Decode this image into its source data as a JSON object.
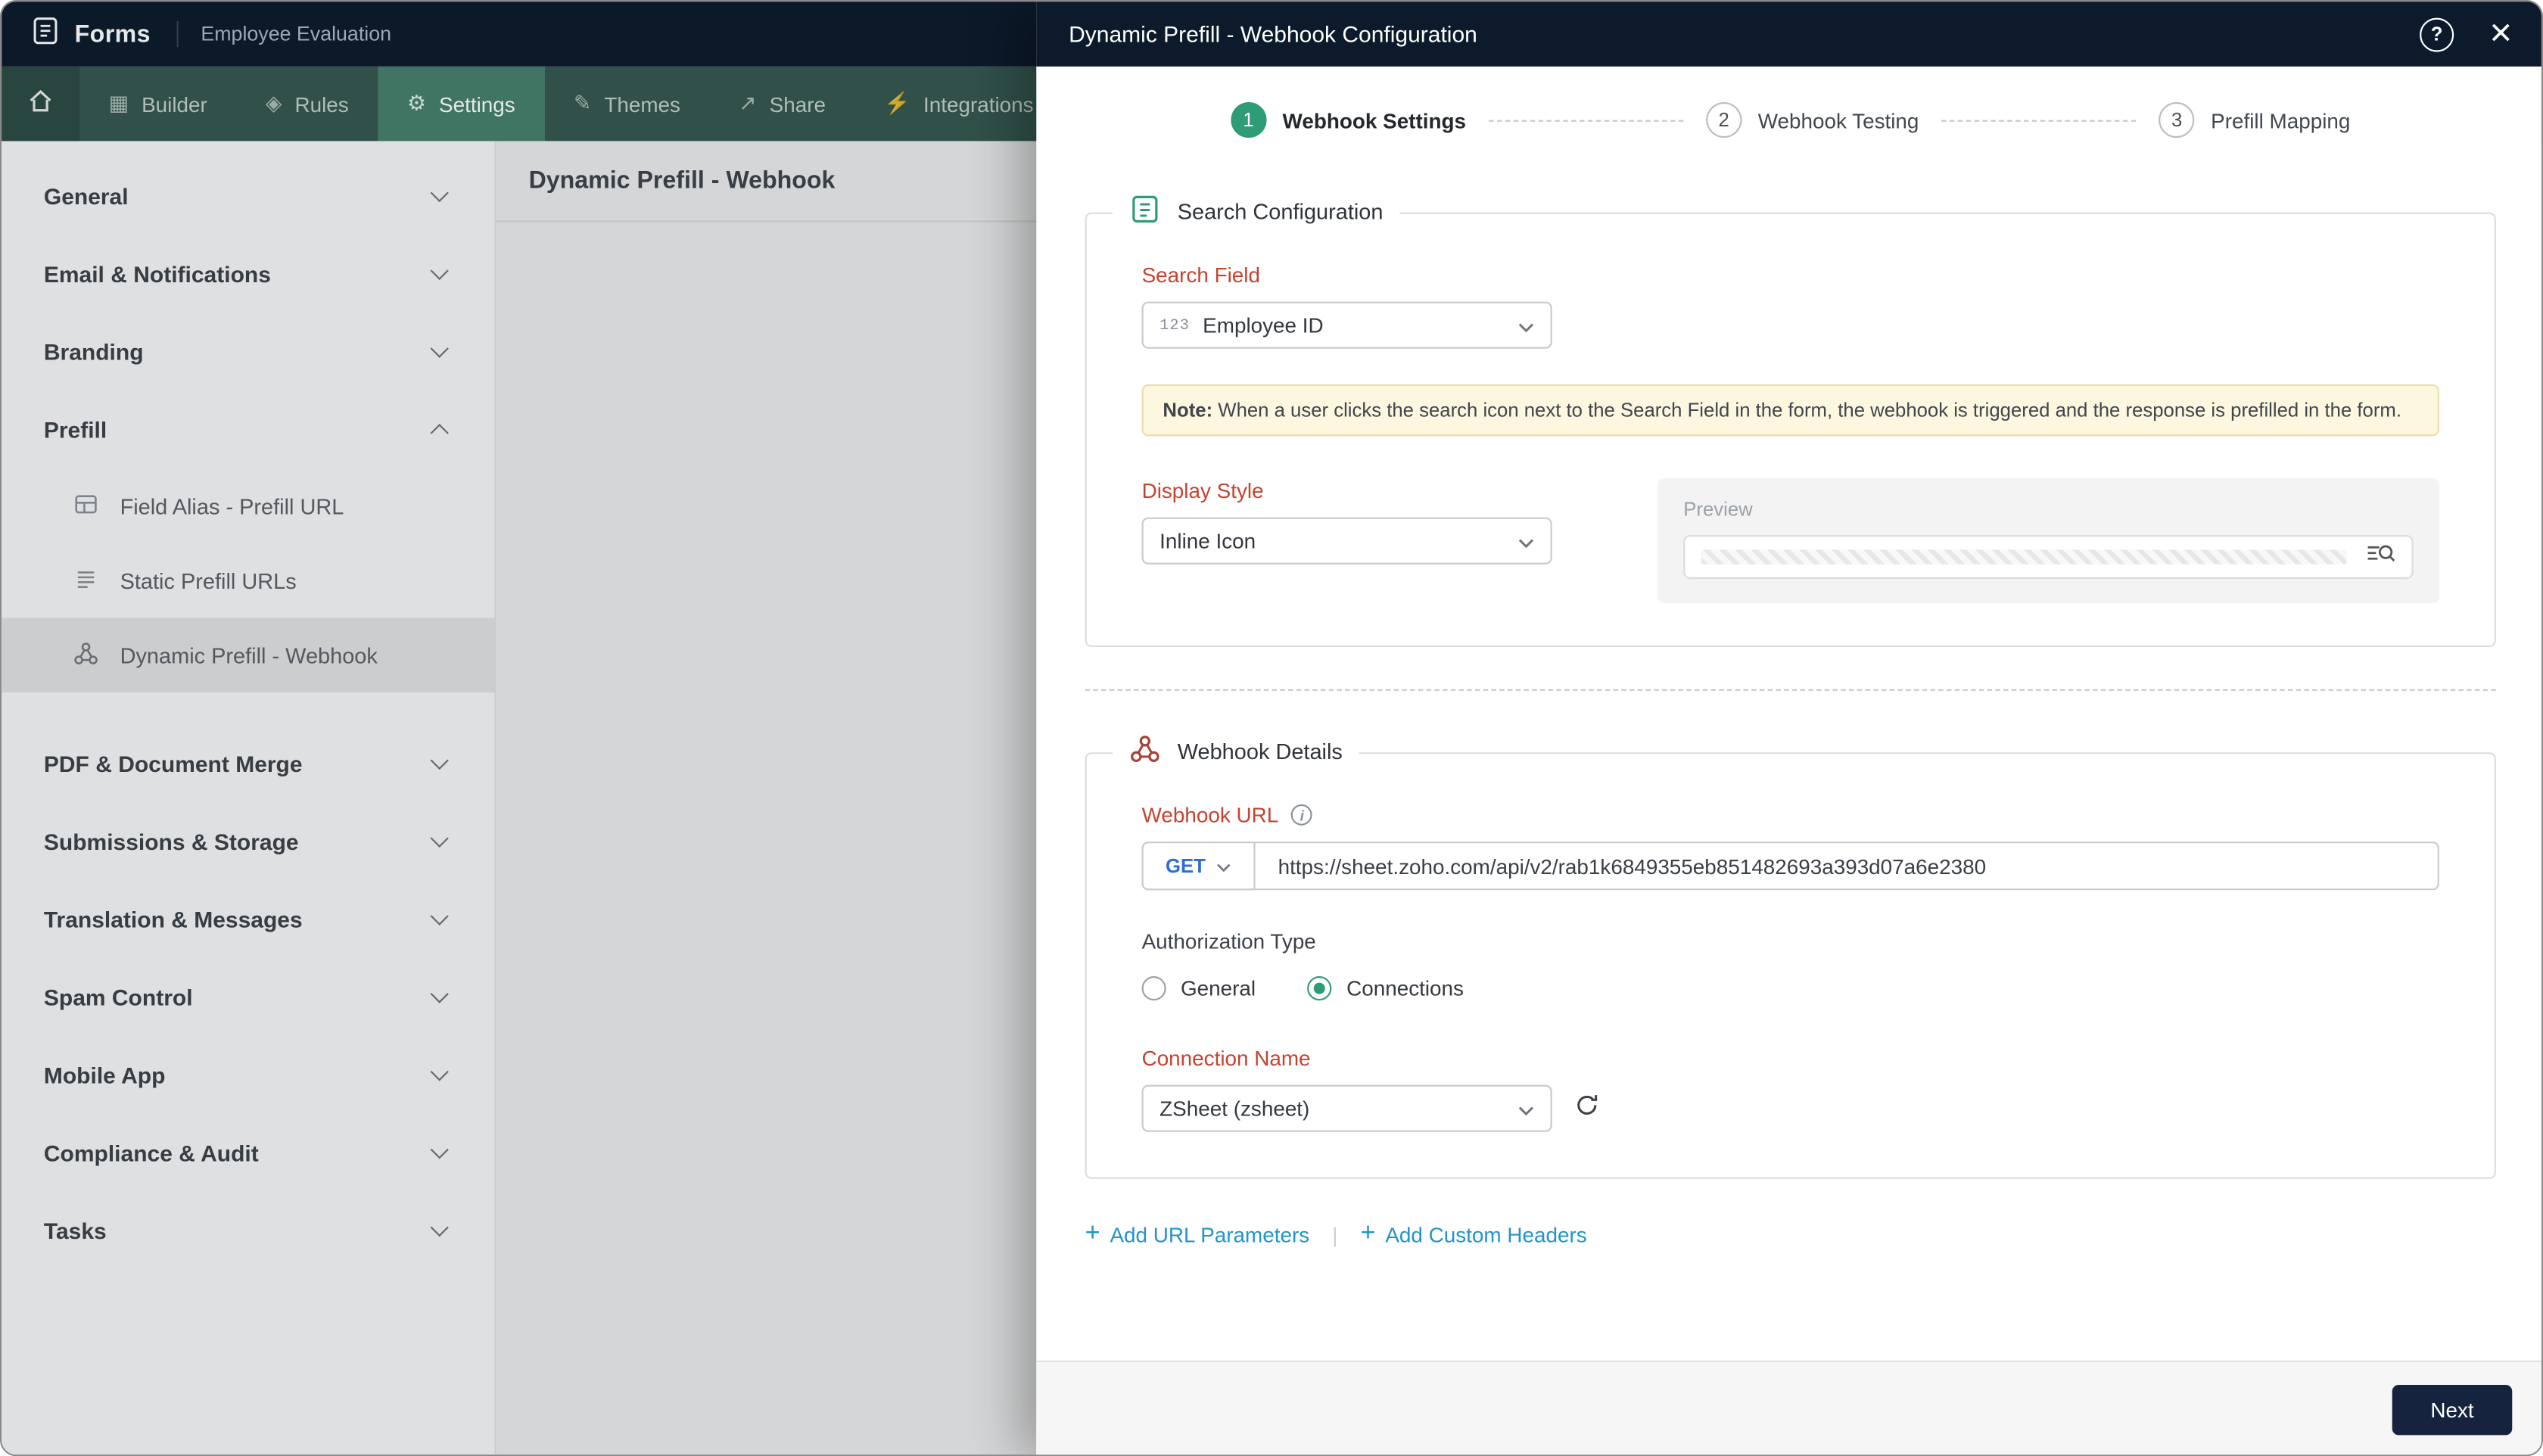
{
  "window": {
    "app_name": "Forms",
    "form_name": "Employee Evaluation"
  },
  "topnav": {
    "items": [
      "Builder",
      "Rules",
      "Settings",
      "Themes",
      "Share",
      "Integrations"
    ],
    "active": "Settings"
  },
  "sidebar": {
    "sections": [
      {
        "label": "General"
      },
      {
        "label": "Email & Notifications"
      },
      {
        "label": "Branding"
      },
      {
        "label": "Prefill"
      },
      {
        "label": "PDF & Document Merge"
      },
      {
        "label": "Submissions & Storage"
      },
      {
        "label": "Translation & Messages"
      },
      {
        "label": "Spam Control"
      },
      {
        "label": "Mobile App"
      },
      {
        "label": "Compliance & Audit"
      },
      {
        "label": "Tasks"
      }
    ],
    "prefill_items": [
      {
        "label": "Field Alias - Prefill URL"
      },
      {
        "label": "Static Prefill URLs"
      },
      {
        "label": "Dynamic Prefill - Webhook",
        "selected": true
      }
    ]
  },
  "content": {
    "page_title": "Dynamic Prefill - Webhook"
  },
  "modal": {
    "title": "Dynamic Prefill - Webhook Configuration",
    "steps": [
      {
        "num": "1",
        "label": "Webhook Settings",
        "state": "active"
      },
      {
        "num": "2",
        "label": "Webhook Testing",
        "state": "upcoming"
      },
      {
        "num": "3",
        "label": "Prefill Mapping",
        "state": "upcoming"
      }
    ],
    "search_config": {
      "legend": "Search Configuration",
      "search_field_label": "Search Field",
      "search_field_icon": "123",
      "search_field_value": "Employee ID",
      "note_label": "Note:",
      "note_text": " When a user clicks the search icon next to the Search Field in the form, the webhook is triggered and the response is prefilled in the form.",
      "display_style_label": "Display Style",
      "display_style_value": "Inline Icon",
      "preview_label": "Preview"
    },
    "webhook_details": {
      "legend": "Webhook Details",
      "url_label": "Webhook URL",
      "method": "GET",
      "url_value": "https://sheet.zoho.com/api/v2/rab1k6849355eb851482693a393d07a6e2380",
      "auth_label": "Authorization Type",
      "auth_option_general": "General",
      "auth_option_connections": "Connections",
      "auth_selected": "Connections",
      "connection_label": "Connection Name",
      "connection_value": "ZSheet (zsheet)"
    },
    "actions": {
      "plus": "+",
      "add_url_parameters": "Add URL Parameters",
      "add_custom_headers": "Add Custom Headers"
    },
    "footer": {
      "next": "Next"
    }
  },
  "colors": {
    "accent_green": "#2e9c76",
    "label_red": "#c6432f",
    "header_navy": "#0d1a2b",
    "link_blue": "#2493c9",
    "method_blue": "#2f6bd8",
    "nav_green": "#35574e",
    "nav_active_green": "#47806c"
  }
}
